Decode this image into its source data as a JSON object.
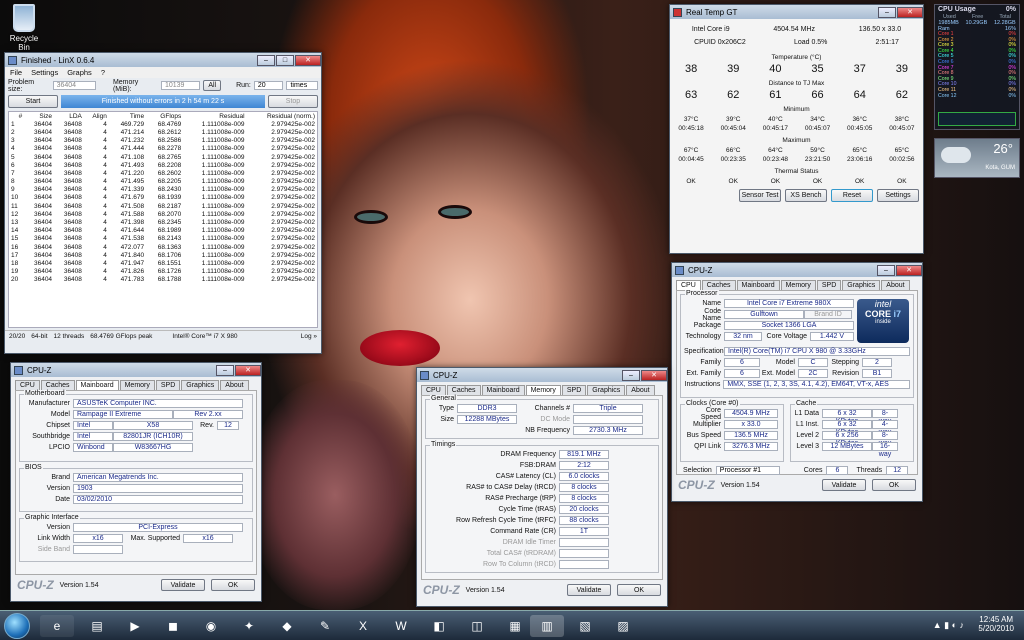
{
  "desktop": {
    "recycle_bin": "Recycle Bin"
  },
  "linx": {
    "title": "Finished - LinX 0.6.4",
    "menu": [
      "File",
      "Settings",
      "Graphs",
      "?"
    ],
    "problem_size_label": "Problem size:",
    "problem_size": "36404",
    "memory_label": "Memory (MiB):",
    "memory": "10139",
    "all_btn": "All",
    "run_label": "Run:",
    "runs": "20",
    "times": "times",
    "start_btn": "Start",
    "stop_btn": "Stop",
    "progress_text": "Finished without errors in 2 h 54 m 22 s",
    "columns": [
      "#",
      "Size",
      "LDA",
      "Align",
      "Time",
      "GFlops",
      "Residual",
      "Residual (norm.)"
    ],
    "rows": [
      [
        "1",
        "36404",
        "36408",
        "4",
        "469.729",
        "68.4769",
        "1.111008e-009",
        "2.979425e-002"
      ],
      [
        "2",
        "36404",
        "36408",
        "4",
        "471.214",
        "68.2612",
        "1.111008e-009",
        "2.979425e-002"
      ],
      [
        "3",
        "36404",
        "36408",
        "4",
        "471.232",
        "68.2586",
        "1.111008e-009",
        "2.979425e-002"
      ],
      [
        "4",
        "36404",
        "36408",
        "4",
        "471.444",
        "68.2278",
        "1.111008e-009",
        "2.979425e-002"
      ],
      [
        "5",
        "36404",
        "36408",
        "4",
        "471.108",
        "68.2765",
        "1.111008e-009",
        "2.979425e-002"
      ],
      [
        "6",
        "36404",
        "36408",
        "4",
        "471.493",
        "68.2208",
        "1.111008e-009",
        "2.979425e-002"
      ],
      [
        "7",
        "36404",
        "36408",
        "4",
        "471.220",
        "68.2602",
        "1.111008e-009",
        "2.979425e-002"
      ],
      [
        "8",
        "36404",
        "36408",
        "4",
        "471.495",
        "68.2205",
        "1.111008e-009",
        "2.979425e-002"
      ],
      [
        "9",
        "36404",
        "36408",
        "4",
        "471.339",
        "68.2430",
        "1.111008e-009",
        "2.979425e-002"
      ],
      [
        "10",
        "36404",
        "36408",
        "4",
        "471.679",
        "68.1939",
        "1.111008e-009",
        "2.979425e-002"
      ],
      [
        "11",
        "36404",
        "36408",
        "4",
        "471.508",
        "68.2187",
        "1.111008e-009",
        "2.979425e-002"
      ],
      [
        "12",
        "36404",
        "36408",
        "4",
        "471.588",
        "68.2070",
        "1.111008e-009",
        "2.979425e-002"
      ],
      [
        "13",
        "36404",
        "36408",
        "4",
        "471.398",
        "68.2345",
        "1.111008e-009",
        "2.979425e-002"
      ],
      [
        "14",
        "36404",
        "36408",
        "4",
        "471.644",
        "68.1989",
        "1.111008e-009",
        "2.979425e-002"
      ],
      [
        "15",
        "36404",
        "36408",
        "4",
        "471.538",
        "68.2143",
        "1.111008e-009",
        "2.979425e-002"
      ],
      [
        "16",
        "36404",
        "36408",
        "4",
        "472.077",
        "68.1363",
        "1.111008e-009",
        "2.979425e-002"
      ],
      [
        "17",
        "36404",
        "36408",
        "4",
        "471.840",
        "68.1706",
        "1.111008e-009",
        "2.979425e-002"
      ],
      [
        "18",
        "36404",
        "36408",
        "4",
        "471.947",
        "68.1551",
        "1.111008e-009",
        "2.979425e-002"
      ],
      [
        "19",
        "36404",
        "36408",
        "4",
        "471.826",
        "68.1726",
        "1.111008e-009",
        "2.979425e-002"
      ],
      [
        "20",
        "36404",
        "36408",
        "4",
        "471.783",
        "68.1788",
        "1.111008e-009",
        "2.979425e-002"
      ]
    ],
    "status": [
      "20/20",
      "64-bit",
      "12 threads",
      "68.4769 GFlops peak",
      "Intel® Core™ i7 X 980",
      "Log »"
    ]
  },
  "realtemp": {
    "title": "Real Temp GT",
    "cpu": "Intel Core i9",
    "mhz": "4504.54 MHz",
    "mult": "136.50 x 33.0",
    "cpuid": "CPUID  0x206C2",
    "load": "Load  0.5%",
    "time": "2:51:17",
    "temp_title": "Temperature (°C)",
    "temps": [
      "38",
      "39",
      "40",
      "35",
      "37",
      "39"
    ],
    "tj_title": "Distance to TJ Max",
    "tj": [
      "63",
      "62",
      "61",
      "66",
      "64",
      "62"
    ],
    "min_title": "Minimum",
    "min": [
      "37°C",
      "39°C",
      "40°C",
      "34°C",
      "36°C",
      "38°C"
    ],
    "min_t": [
      "00:45:18",
      "00:45:04",
      "00:45:17",
      "00:45:07",
      "00:45:05",
      "00:45:07"
    ],
    "max_title": "Maximum",
    "max": [
      "67°C",
      "66°C",
      "64°C",
      "59°C",
      "65°C",
      "65°C"
    ],
    "max_t": [
      "00:04:45",
      "00:23:35",
      "00:23:48",
      "23:21:50",
      "23:06:16",
      "00:02:56"
    ],
    "thermal_title": "Thermal Status",
    "thermal": [
      "OK",
      "OK",
      "OK",
      "OK",
      "OK",
      "OK"
    ],
    "buttons": [
      "Sensor Test",
      "XS Bench",
      "Reset",
      "Settings"
    ]
  },
  "gadget": {
    "title": "CPU Usage",
    "pct": "0%",
    "hdr": [
      "Used",
      "Free",
      "Total"
    ],
    "vals": [
      "1985MB",
      "10.29GB",
      "12.28GB"
    ],
    "ram": "Ram",
    "ram_pct": "16%",
    "cores": [
      "Core 1",
      "Core 2",
      "Core 3",
      "Core 4",
      "Core 5",
      "Core 6",
      "Core 7",
      "Core 8",
      "Core 9",
      "Core 10",
      "Core 11",
      "Core 12"
    ],
    "core_pct": "0%",
    "weather_temp": "26°",
    "weather_loc": "Kota, GUM"
  },
  "cpuz_cpu": {
    "title": "CPU-Z",
    "tabs": [
      "CPU",
      "Caches",
      "Mainboard",
      "Memory",
      "SPD",
      "Graphics",
      "About"
    ],
    "processor": "Processor",
    "name_l": "Name",
    "name": "Intel Core i7 Extreme 980X",
    "code_l": "Code Name",
    "code": "Gulftown",
    "brand_l": "Brand ID",
    "pkg_l": "Package",
    "pkg": "Socket 1366 LGA",
    "tech_l": "Technology",
    "tech": "32 nm",
    "volt_l": "Core Voltage",
    "volt": "1.442 V",
    "spec_l": "Specification",
    "spec": "Intel(R) Core(TM) i7 CPU     X 980  @ 3.33GHz",
    "fam_l": "Family",
    "fam": "6",
    "model_l": "Model",
    "model": "C",
    "step_l": "Stepping",
    "step": "2",
    "efam_l": "Ext. Family",
    "efam": "6",
    "emodel_l": "Ext. Model",
    "emodel": "2C",
    "rev_l": "Revision",
    "rev": "B1",
    "inst_l": "Instructions",
    "inst": "MMX, SSE (1, 2, 3, 3S, 4.1, 4.2), EM64T, VT-x, AES",
    "clocks": "Clocks (Core #0)",
    "cache": "Cache",
    "cs_l": "Core Speed",
    "cs": "4504.9 MHz",
    "mul_l": "Multiplier",
    "mul": "x 33.0",
    "bus_l": "Bus Speed",
    "bus": "136.5 MHz",
    "qpi_l": "QPI Link",
    "qpi": "3276.3 MHz",
    "l1d_l": "L1 Data",
    "l1d": "6 x 32 KBytes",
    "l1d_w": "8-way",
    "l1i_l": "L1 Inst.",
    "l1i": "6 x 32 KBytes",
    "l1i_w": "4-way",
    "l2_l": "Level 2",
    "l2": "6 x 256 KBytes",
    "l2_w": "8-way",
    "l3_l": "Level 3",
    "l3": "12 MBytes",
    "l3_w": "16-way",
    "sel_l": "Selection",
    "sel": "Processor #1",
    "cores_l": "Cores",
    "cores": "6",
    "thr_l": "Threads",
    "thr": "12",
    "logo": "CPU-Z",
    "ver": "Version 1.54",
    "validate": "Validate",
    "ok": "OK",
    "intel": [
      "intel",
      "CORE",
      "i7",
      "inside"
    ]
  },
  "cpuz_mb": {
    "title": "CPU-Z",
    "tabs": [
      "CPU",
      "Caches",
      "Mainboard",
      "Memory",
      "SPD",
      "Graphics",
      "About"
    ],
    "mb": "Motherboard",
    "man_l": "Manufacturer",
    "man": "ASUSTeK Computer INC.",
    "model_l": "Model",
    "model": "Rampage II Extreme",
    "modrev": "Rev 2.xx",
    "chip_l": "Chipset",
    "chip": "Intel",
    "chip2": "X58",
    "rev_l": "Rev.",
    "rev": "12",
    "sb_l": "Southbridge",
    "sb": "Intel",
    "sb2": "82801JR (ICH10R)",
    "lpc_l": "LPCIO",
    "lpc": "Winbond",
    "lpc2": "W83667HG",
    "bios": "BIOS",
    "brand_l": "Brand",
    "brand": "American Megatrends Inc.",
    "ver_l": "Version",
    "biosver": "1903",
    "date_l": "Date",
    "date": "03/02/2010",
    "gi": "Graphic Interface",
    "giv_l": "Version",
    "giv": "PCI-Express",
    "lw_l": "Link Width",
    "lw": "x16",
    "ms_l": "Max. Supported",
    "ms": "x16",
    "sb_band": "Side Band",
    "logo": "CPU-Z",
    "ver": "Version 1.54",
    "validate": "Validate",
    "ok": "OK"
  },
  "cpuz_mem": {
    "title": "CPU-Z",
    "tabs": [
      "CPU",
      "Caches",
      "Mainboard",
      "Memory",
      "SPD",
      "Graphics",
      "About"
    ],
    "general": "General",
    "type_l": "Type",
    "type": "DDR3",
    "ch_l": "Channels #",
    "ch": "Triple",
    "size_l": "Size",
    "size": "12288 MBytes",
    "dc_l": "DC Mode",
    "nb_l": "NB Frequency",
    "nb": "2730.3 MHz",
    "timings": "Timings",
    "t": [
      [
        "DRAM Frequency",
        "819.1 MHz"
      ],
      [
        "FSB:DRAM",
        "2:12"
      ],
      [
        "CAS# Latency (CL)",
        "6.0 clocks"
      ],
      [
        "RAS# to CAS# Delay (tRCD)",
        "8 clocks"
      ],
      [
        "RAS# Precharge (tRP)",
        "8 clocks"
      ],
      [
        "Cycle Time (tRAS)",
        "20 clocks"
      ],
      [
        "Row Refresh Cycle Time (tRFC)",
        "88 clocks"
      ],
      [
        "Command Rate (CR)",
        "1T"
      ],
      [
        "DRAM Idle Timer",
        ""
      ],
      [
        "Total CAS# (tRDRAM)",
        ""
      ],
      [
        "Row To Column (tRCD)",
        ""
      ]
    ],
    "logo": "CPU-Z",
    "ver": "Version 1.54",
    "validate": "Validate",
    "ok": "OK"
  },
  "taskbar": {
    "time": "12:45 AM",
    "date": "5/20/2010"
  }
}
